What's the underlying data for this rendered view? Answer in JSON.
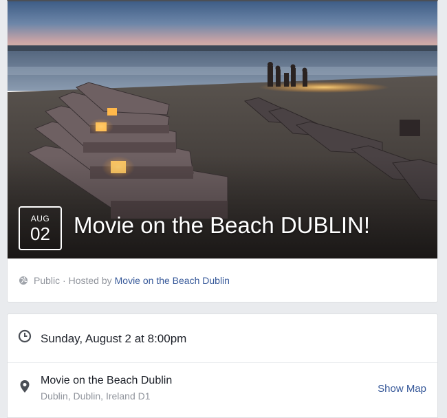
{
  "event": {
    "date_month": "AUG",
    "date_day": "02",
    "title": "Movie on the Beach DUBLIN!",
    "privacy": "Public",
    "hosted_by_prefix": "· Hosted by",
    "host_name": "Movie on the Beach Dublin"
  },
  "details": {
    "time_text": "Sunday, August 2 at 8:00pm",
    "location_name": "Movie on the Beach Dublin",
    "location_address": "Dublin, Dublin, Ireland D1",
    "show_map_label": "Show Map"
  },
  "icons": {
    "privacy": "globe-icon",
    "time": "clock-icon",
    "location": "map-pin-icon"
  },
  "colors": {
    "link": "#365899",
    "muted": "#90949c",
    "page_bg": "#e9ebee"
  }
}
